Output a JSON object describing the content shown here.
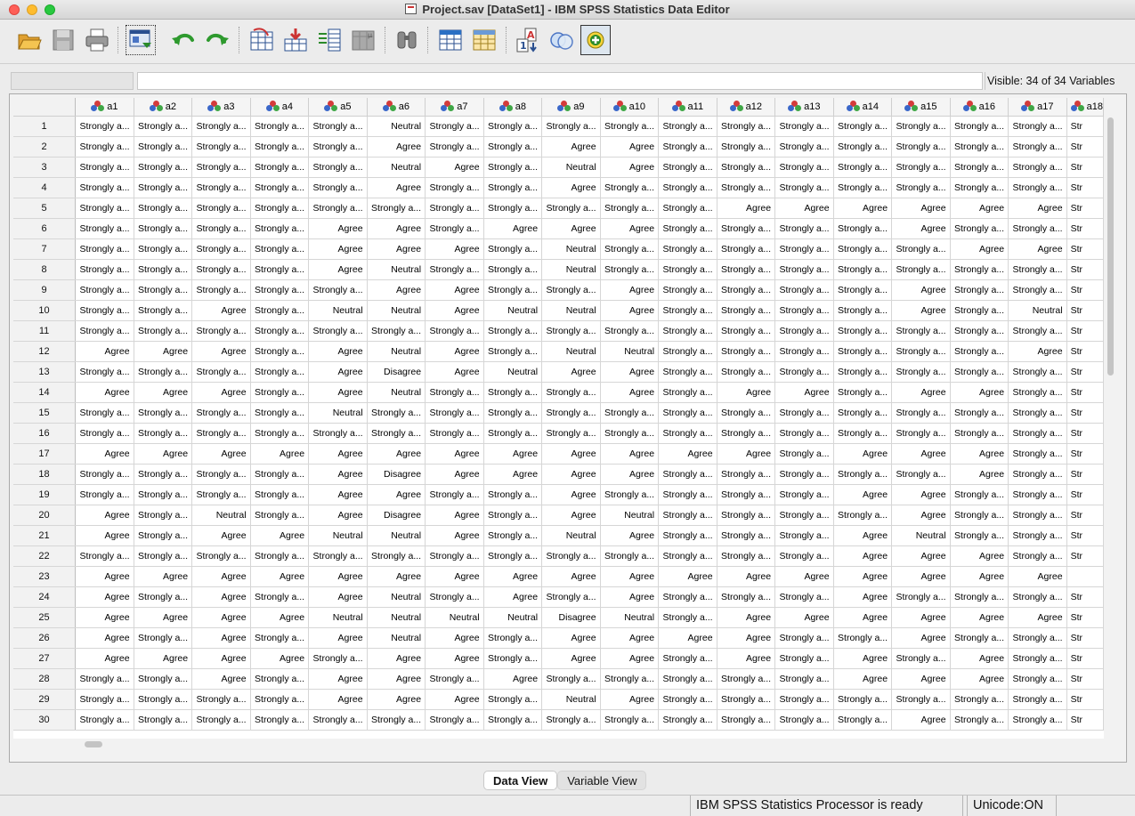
{
  "window": {
    "title": "Project.sav [DataSet1] - IBM SPSS Statistics Data Editor"
  },
  "toolbar": {
    "items": [
      "open-file-icon",
      "save-icon",
      "print-icon",
      "recall-dialog-icon",
      "undo-icon",
      "redo-icon",
      "goto-case-icon",
      "goto-variable-icon",
      "variables-icon",
      "descriptives-icon",
      "find-icon",
      "insert-cases-icon",
      "insert-variable-icon",
      "split-file-icon",
      "weight-cases-icon",
      "value-labels-icon",
      "use-sets-icon"
    ]
  },
  "cell_editor": {
    "visible_label": "Visible: 34 of 34 Variables"
  },
  "columns": [
    "a1",
    "a2",
    "a3",
    "a4",
    "a5",
    "a6",
    "a7",
    "a8",
    "a9",
    "a10",
    "a11",
    "a12",
    "a13",
    "a14",
    "a15",
    "a16",
    "a17",
    "a18"
  ],
  "rows": [
    {
      "n": "1",
      "v": [
        "Strongly a...",
        "Strongly a...",
        "Strongly a...",
        "Strongly a...",
        "Strongly a...",
        "Neutral",
        "Strongly a...",
        "Strongly a...",
        "Strongly a...",
        "Strongly a...",
        "Strongly a...",
        "Strongly a...",
        "Strongly a...",
        "Strongly a...",
        "Strongly a...",
        "Strongly a...",
        "Strongly a...",
        "Str"
      ]
    },
    {
      "n": "2",
      "v": [
        "Strongly a...",
        "Strongly a...",
        "Strongly a...",
        "Strongly a...",
        "Strongly a...",
        "Agree",
        "Strongly a...",
        "Strongly a...",
        "Agree",
        "Agree",
        "Strongly a...",
        "Strongly a...",
        "Strongly a...",
        "Strongly a...",
        "Strongly a...",
        "Strongly a...",
        "Strongly a...",
        "Str"
      ]
    },
    {
      "n": "3",
      "v": [
        "Strongly a...",
        "Strongly a...",
        "Strongly a...",
        "Strongly a...",
        "Strongly a...",
        "Neutral",
        "Agree",
        "Strongly a...",
        "Neutral",
        "Agree",
        "Strongly a...",
        "Strongly a...",
        "Strongly a...",
        "Strongly a...",
        "Strongly a...",
        "Strongly a...",
        "Strongly a...",
        "Str"
      ]
    },
    {
      "n": "4",
      "v": [
        "Strongly a...",
        "Strongly a...",
        "Strongly a...",
        "Strongly a...",
        "Strongly a...",
        "Agree",
        "Strongly a...",
        "Strongly a...",
        "Agree",
        "Strongly a...",
        "Strongly a...",
        "Strongly a...",
        "Strongly a...",
        "Strongly a...",
        "Strongly a...",
        "Strongly a...",
        "Strongly a...",
        "Str"
      ]
    },
    {
      "n": "5",
      "v": [
        "Strongly a...",
        "Strongly a...",
        "Strongly a...",
        "Strongly a...",
        "Strongly a...",
        "Strongly a...",
        "Strongly a...",
        "Strongly a...",
        "Strongly a...",
        "Strongly a...",
        "Strongly a...",
        "Agree",
        "Agree",
        "Agree",
        "Agree",
        "Agree",
        "Agree",
        "Str"
      ]
    },
    {
      "n": "6",
      "v": [
        "Strongly a...",
        "Strongly a...",
        "Strongly a...",
        "Strongly a...",
        "Agree",
        "Agree",
        "Strongly a...",
        "Agree",
        "Agree",
        "Agree",
        "Strongly a...",
        "Strongly a...",
        "Strongly a...",
        "Strongly a...",
        "Agree",
        "Strongly a...",
        "Strongly a...",
        "Str"
      ]
    },
    {
      "n": "7",
      "v": [
        "Strongly a...",
        "Strongly a...",
        "Strongly a...",
        "Strongly a...",
        "Agree",
        "Agree",
        "Agree",
        "Strongly a...",
        "Neutral",
        "Strongly a...",
        "Strongly a...",
        "Strongly a...",
        "Strongly a...",
        "Strongly a...",
        "Strongly a...",
        "Agree",
        "Agree",
        "Str"
      ]
    },
    {
      "n": "8",
      "v": [
        "Strongly a...",
        "Strongly a...",
        "Strongly a...",
        "Strongly a...",
        "Agree",
        "Neutral",
        "Strongly a...",
        "Strongly a...",
        "Neutral",
        "Strongly a...",
        "Strongly a...",
        "Strongly a...",
        "Strongly a...",
        "Strongly a...",
        "Strongly a...",
        "Strongly a...",
        "Strongly a...",
        "Str"
      ]
    },
    {
      "n": "9",
      "v": [
        "Strongly a...",
        "Strongly a...",
        "Strongly a...",
        "Strongly a...",
        "Strongly a...",
        "Agree",
        "Agree",
        "Strongly a...",
        "Strongly a...",
        "Agree",
        "Strongly a...",
        "Strongly a...",
        "Strongly a...",
        "Strongly a...",
        "Agree",
        "Strongly a...",
        "Strongly a...",
        "Str"
      ]
    },
    {
      "n": "10",
      "v": [
        "Strongly a...",
        "Strongly a...",
        "Agree",
        "Strongly a...",
        "Neutral",
        "Neutral",
        "Agree",
        "Neutral",
        "Neutral",
        "Agree",
        "Strongly a...",
        "Strongly a...",
        "Strongly a...",
        "Strongly a...",
        "Agree",
        "Strongly a...",
        "Neutral",
        "Str"
      ]
    },
    {
      "n": "11",
      "v": [
        "Strongly a...",
        "Strongly a...",
        "Strongly a...",
        "Strongly a...",
        "Strongly a...",
        "Strongly a...",
        "Strongly a...",
        "Strongly a...",
        "Strongly a...",
        "Strongly a...",
        "Strongly a...",
        "Strongly a...",
        "Strongly a...",
        "Strongly a...",
        "Strongly a...",
        "Strongly a...",
        "Strongly a...",
        "Str"
      ]
    },
    {
      "n": "12",
      "v": [
        "Agree",
        "Agree",
        "Agree",
        "Strongly a...",
        "Agree",
        "Neutral",
        "Agree",
        "Strongly a...",
        "Neutral",
        "Neutral",
        "Strongly a...",
        "Strongly a...",
        "Strongly a...",
        "Strongly a...",
        "Strongly a...",
        "Strongly a...",
        "Agree",
        "Str"
      ]
    },
    {
      "n": "13",
      "v": [
        "Strongly a...",
        "Strongly a...",
        "Strongly a...",
        "Strongly a...",
        "Agree",
        "Disagree",
        "Agree",
        "Neutral",
        "Agree",
        "Agree",
        "Strongly a...",
        "Strongly a...",
        "Strongly a...",
        "Strongly a...",
        "Strongly a...",
        "Strongly a...",
        "Strongly a...",
        "Str"
      ]
    },
    {
      "n": "14",
      "v": [
        "Agree",
        "Agree",
        "Agree",
        "Strongly a...",
        "Agree",
        "Neutral",
        "Strongly a...",
        "Strongly a...",
        "Strongly a...",
        "Agree",
        "Strongly a...",
        "Agree",
        "Agree",
        "Strongly a...",
        "Agree",
        "Agree",
        "Strongly a...",
        "Str"
      ]
    },
    {
      "n": "15",
      "v": [
        "Strongly a...",
        "Strongly a...",
        "Strongly a...",
        "Strongly a...",
        "Neutral",
        "Strongly a...",
        "Strongly a...",
        "Strongly a...",
        "Strongly a...",
        "Strongly a...",
        "Strongly a...",
        "Strongly a...",
        "Strongly a...",
        "Strongly a...",
        "Strongly a...",
        "Strongly a...",
        "Strongly a...",
        "Str"
      ]
    },
    {
      "n": "16",
      "v": [
        "Strongly a...",
        "Strongly a...",
        "Strongly a...",
        "Strongly a...",
        "Strongly a...",
        "Strongly a...",
        "Strongly a...",
        "Strongly a...",
        "Strongly a...",
        "Strongly a...",
        "Strongly a...",
        "Strongly a...",
        "Strongly a...",
        "Strongly a...",
        "Strongly a...",
        "Strongly a...",
        "Strongly a...",
        "Str"
      ]
    },
    {
      "n": "17",
      "v": [
        "Agree",
        "Agree",
        "Agree",
        "Agree",
        "Agree",
        "Agree",
        "Agree",
        "Agree",
        "Agree",
        "Agree",
        "Agree",
        "Agree",
        "Strongly a...",
        "Agree",
        "Agree",
        "Agree",
        "Strongly a...",
        "Str"
      ]
    },
    {
      "n": "18",
      "v": [
        "Strongly a...",
        "Strongly a...",
        "Strongly a...",
        "Strongly a...",
        "Agree",
        "Disagree",
        "Agree",
        "Agree",
        "Agree",
        "Agree",
        "Strongly a...",
        "Strongly a...",
        "Strongly a...",
        "Strongly a...",
        "Strongly a...",
        "Agree",
        "Strongly a...",
        "Str"
      ]
    },
    {
      "n": "19",
      "v": [
        "Strongly a...",
        "Strongly a...",
        "Strongly a...",
        "Strongly a...",
        "Agree",
        "Agree",
        "Strongly a...",
        "Strongly a...",
        "Agree",
        "Strongly a...",
        "Strongly a...",
        "Strongly a...",
        "Strongly a...",
        "Agree",
        "Agree",
        "Strongly a...",
        "Strongly a...",
        "Str"
      ]
    },
    {
      "n": "20",
      "v": [
        "Agree",
        "Strongly a...",
        "Neutral",
        "Strongly a...",
        "Agree",
        "Disagree",
        "Agree",
        "Strongly a...",
        "Agree",
        "Neutral",
        "Strongly a...",
        "Strongly a...",
        "Strongly a...",
        "Strongly a...",
        "Agree",
        "Strongly a...",
        "Strongly a...",
        "Str"
      ]
    },
    {
      "n": "21",
      "v": [
        "Agree",
        "Strongly a...",
        "Agree",
        "Agree",
        "Neutral",
        "Neutral",
        "Agree",
        "Strongly a...",
        "Neutral",
        "Agree",
        "Strongly a...",
        "Strongly a...",
        "Strongly a...",
        "Agree",
        "Neutral",
        "Strongly a...",
        "Strongly a...",
        "Str"
      ]
    },
    {
      "n": "22",
      "v": [
        "Strongly a...",
        "Strongly a...",
        "Strongly a...",
        "Strongly a...",
        "Strongly a...",
        "Strongly a...",
        "Strongly a...",
        "Strongly a...",
        "Strongly a...",
        "Strongly a...",
        "Strongly a...",
        "Strongly a...",
        "Strongly a...",
        "Agree",
        "Agree",
        "Agree",
        "Strongly a...",
        "Str"
      ]
    },
    {
      "n": "23",
      "v": [
        "Agree",
        "Agree",
        "Agree",
        "Agree",
        "Agree",
        "Agree",
        "Agree",
        "Agree",
        "Agree",
        "Agree",
        "Agree",
        "Agree",
        "Agree",
        "Agree",
        "Agree",
        "Agree",
        "Agree",
        ""
      ]
    },
    {
      "n": "24",
      "v": [
        "Agree",
        "Strongly a...",
        "Agree",
        "Strongly a...",
        "Agree",
        "Neutral",
        "Strongly a...",
        "Agree",
        "Strongly a...",
        "Agree",
        "Strongly a...",
        "Strongly a...",
        "Strongly a...",
        "Agree",
        "Strongly a...",
        "Strongly a...",
        "Strongly a...",
        "Str"
      ]
    },
    {
      "n": "25",
      "v": [
        "Agree",
        "Agree",
        "Agree",
        "Agree",
        "Neutral",
        "Neutral",
        "Neutral",
        "Neutral",
        "Disagree",
        "Neutral",
        "Strongly a...",
        "Agree",
        "Agree",
        "Agree",
        "Agree",
        "Agree",
        "Agree",
        "Str"
      ]
    },
    {
      "n": "26",
      "v": [
        "Agree",
        "Strongly a...",
        "Agree",
        "Strongly a...",
        "Agree",
        "Neutral",
        "Agree",
        "Strongly a...",
        "Agree",
        "Agree",
        "Agree",
        "Agree",
        "Strongly a...",
        "Strongly a...",
        "Agree",
        "Strongly a...",
        "Strongly a...",
        "Str"
      ]
    },
    {
      "n": "27",
      "v": [
        "Agree",
        "Agree",
        "Agree",
        "Agree",
        "Strongly a...",
        "Agree",
        "Agree",
        "Strongly a...",
        "Agree",
        "Agree",
        "Strongly a...",
        "Agree",
        "Strongly a...",
        "Agree",
        "Strongly a...",
        "Agree",
        "Strongly a...",
        "Str"
      ]
    },
    {
      "n": "28",
      "v": [
        "Strongly a...",
        "Strongly a...",
        "Agree",
        "Strongly a...",
        "Agree",
        "Agree",
        "Strongly a...",
        "Agree",
        "Strongly a...",
        "Strongly a...",
        "Strongly a...",
        "Strongly a...",
        "Strongly a...",
        "Agree",
        "Agree",
        "Agree",
        "Strongly a...",
        "Str"
      ]
    },
    {
      "n": "29",
      "v": [
        "Strongly a...",
        "Strongly a...",
        "Strongly a...",
        "Strongly a...",
        "Agree",
        "Agree",
        "Agree",
        "Strongly a...",
        "Neutral",
        "Agree",
        "Strongly a...",
        "Strongly a...",
        "Strongly a...",
        "Strongly a...",
        "Strongly a...",
        "Strongly a...",
        "Strongly a...",
        "Str"
      ]
    },
    {
      "n": "30",
      "v": [
        "Strongly a...",
        "Strongly a...",
        "Strongly a...",
        "Strongly a...",
        "Strongly a...",
        "Strongly a...",
        "Strongly a...",
        "Strongly a...",
        "Strongly a...",
        "Strongly a...",
        "Strongly a...",
        "Strongly a...",
        "Strongly a...",
        "Strongly a...",
        "Agree",
        "Strongly a...",
        "Strongly a...",
        "Str"
      ]
    }
  ],
  "view_tabs": {
    "data_view": "Data View",
    "variable_view": "Variable View"
  },
  "status": {
    "processor": "IBM SPSS Statistics Processor is ready",
    "unicode": "Unicode:ON"
  }
}
